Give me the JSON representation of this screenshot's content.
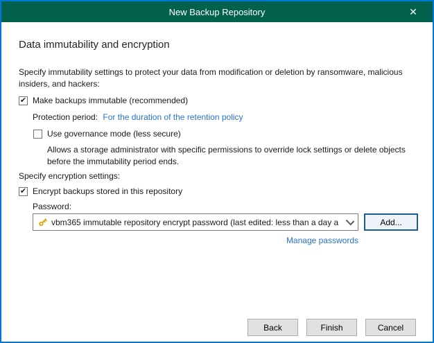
{
  "window": {
    "title": "New Backup Repository",
    "close_glyph": "✕",
    "colors": {
      "titlebar": "#01614d",
      "window_border": "#0078d7",
      "link": "#2672cb",
      "default_button_border": "#1b5c9c"
    }
  },
  "page": {
    "heading": "Data immutability and encryption",
    "immutability": {
      "intro": "Specify immutability settings to protect your data from modification or deletion by ransomware, malicious insiders, and hackers:",
      "make_immutable": {
        "label": "Make backups immutable (recommended)",
        "checked": true,
        "glyph": "✔"
      },
      "protection_period_label": "Protection period:",
      "protection_period_link": "For the duration of the retention policy",
      "governance": {
        "label": "Use governance mode (less secure)",
        "checked": false,
        "glyph": ""
      },
      "governance_description": "Allows a storage administrator with specific permissions to override lock settings or delete objects before the immutability period ends."
    },
    "encryption": {
      "intro": "Specify encryption settings:",
      "encrypt": {
        "label": "Encrypt backups stored in this repository",
        "checked": true,
        "glyph": "✔"
      },
      "password_label": "Password:",
      "password_selected_value": "vbm365 immutable repository encrypt password (last edited: less than a day a",
      "add_button_label": "Add...",
      "manage_passwords_link": "Manage passwords"
    }
  },
  "footer": {
    "back_label": "Back",
    "finish_label": "Finish",
    "cancel_label": "Cancel"
  }
}
